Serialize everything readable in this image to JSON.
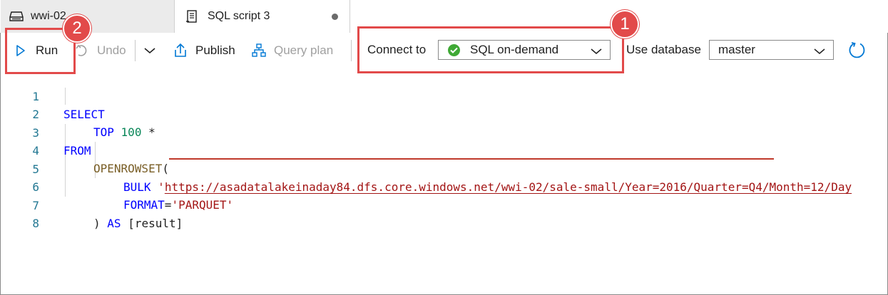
{
  "tabs": [
    {
      "label": "wwi-02",
      "icon": "database-icon",
      "active": false
    },
    {
      "label": "SQL script 3",
      "icon": "script-icon",
      "active": true,
      "dirty": true
    }
  ],
  "toolbar": {
    "run_label": "Run",
    "undo_label": "Undo",
    "publish_label": "Publish",
    "query_plan_label": "Query plan",
    "connect_to_label": "Connect to",
    "connect_to_value": "SQL on-demand",
    "use_database_label": "Use database",
    "database_value": "master"
  },
  "callouts": {
    "first": "1",
    "second": "2"
  },
  "editor": {
    "lines": [
      {
        "n": "1"
      },
      {
        "n": "2"
      },
      {
        "n": "3"
      },
      {
        "n": "4"
      },
      {
        "n": "5"
      },
      {
        "n": "6"
      },
      {
        "n": "7"
      },
      {
        "n": "8"
      }
    ],
    "tokens": {
      "select": "SELECT",
      "top": "TOP",
      "top_n": "100",
      "star": "*",
      "from": "FROM",
      "openrowset": "OPENROWSET",
      "open_paren": "(",
      "bulk": "BULK",
      "quote": "'",
      "url": "https://asadatalakeinaday84.dfs.core.windows.net/wwi-02/sale-small/Year=2016/Quarter=Q4/Month=12/Day",
      "format": "FORMAT",
      "equals": "=",
      "parquet": "'PARQUET'",
      "close_paren": ")",
      "as": "AS",
      "alias": "[result]"
    }
  },
  "colors": {
    "callout": "#e24a4a",
    "status_ok": "#3fa935",
    "keyword": "#0000ff",
    "string": "#a31515",
    "number": "#098658",
    "function": "#795e26",
    "line_number": "#237893",
    "refresh_icon": "#0078d4"
  }
}
